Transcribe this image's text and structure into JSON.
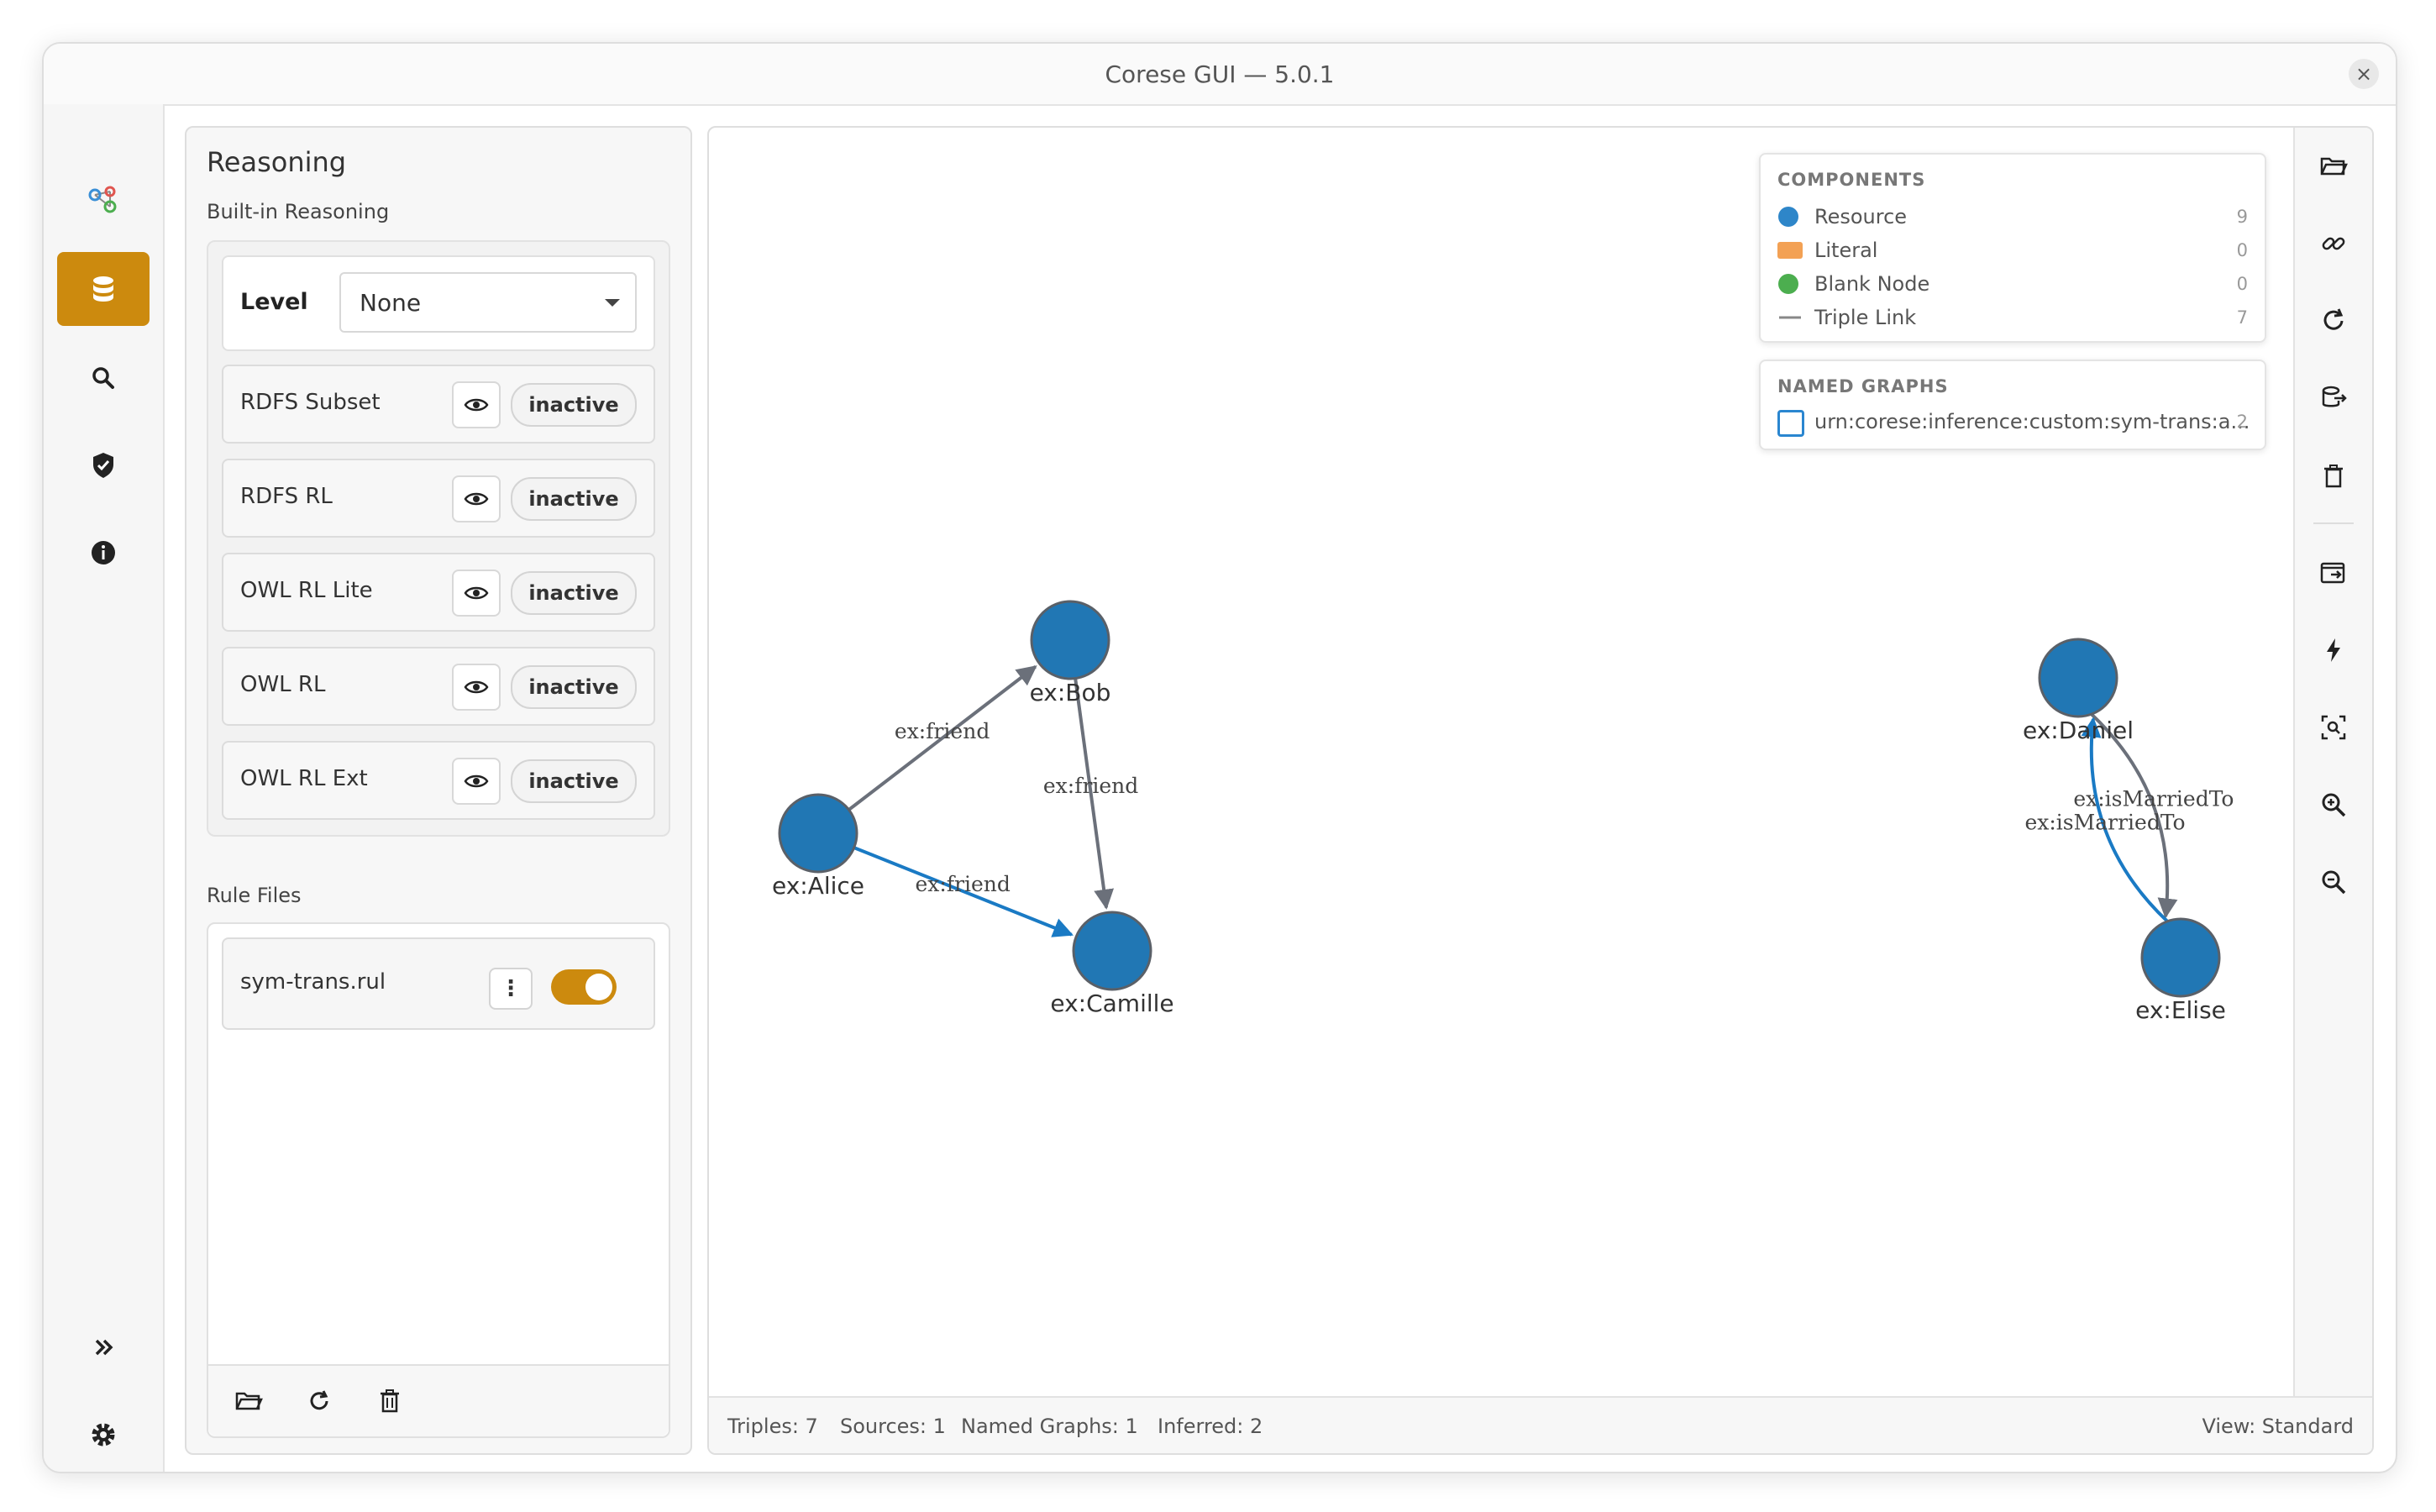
{
  "window": {
    "title": "Corese GUI — 5.0.1",
    "close_icon": "×"
  },
  "nav": {
    "items": [
      {
        "name": "graph-logo",
        "icon": "graph-logo-icon"
      },
      {
        "name": "data",
        "icon": "database-icon",
        "active": true
      },
      {
        "name": "query",
        "icon": "search-icon"
      },
      {
        "name": "validation",
        "icon": "shield-check-icon"
      },
      {
        "name": "about",
        "icon": "info-icon"
      },
      {
        "name": "expand",
        "icon": "double-chevron-right-icon"
      },
      {
        "name": "settings",
        "icon": "gear-icon"
      }
    ],
    "accent": "#cc8a0e"
  },
  "reasoning": {
    "title": "Reasoning",
    "builtin_label": "Built-in Reasoning",
    "level_label": "Level",
    "level_value": "None",
    "rules": [
      {
        "name": "RDFS Subset",
        "state": "inactive"
      },
      {
        "name": "RDFS RL",
        "state": "inactive"
      },
      {
        "name": "OWL RL Lite",
        "state": "inactive"
      },
      {
        "name": "OWL RL",
        "state": "inactive"
      },
      {
        "name": "OWL RL Ext",
        "state": "inactive"
      }
    ],
    "rule_files_label": "Rule Files",
    "files": [
      {
        "name": "sym-trans.rul",
        "enabled": true,
        "menu_glyph": "⋮"
      }
    ]
  },
  "graph": {
    "nodes": [
      {
        "id": "ex:Alice",
        "label": "ex:Alice"
      },
      {
        "id": "ex:Bob",
        "label": "ex:Bob"
      },
      {
        "id": "ex:Camille",
        "label": "ex:Camille"
      },
      {
        "id": "ex:Daniel",
        "label": "ex:Daniel"
      },
      {
        "id": "ex:Elise",
        "label": "ex:Elise"
      }
    ],
    "edges": [
      {
        "from": "ex:Alice",
        "to": "ex:Bob",
        "label": "ex:friend",
        "inferred": false
      },
      {
        "from": "ex:Bob",
        "to": "ex:Camille",
        "label": "ex:friend",
        "inferred": false
      },
      {
        "from": "ex:Alice",
        "to": "ex:Camille",
        "label": "ex:friend",
        "inferred": true
      },
      {
        "from": "ex:Daniel",
        "to": "ex:Elise",
        "label": "ex:isMarriedTo",
        "inferred": false
      },
      {
        "from": "ex:Elise",
        "to": "ex:Daniel",
        "label": "ex:isMarriedTo",
        "inferred": true
      }
    ],
    "colors": {
      "resource": "#2177b4",
      "edge": "#6b707a",
      "inferred_edge": "#1a7ac4"
    }
  },
  "legend": {
    "components_title": "COMPONENTS",
    "items": [
      {
        "label": "Resource",
        "count": "9",
        "color": "#2e86c9",
        "shape": "circle"
      },
      {
        "label": "Literal",
        "count": "0",
        "color": "#f3a154",
        "shape": "square"
      },
      {
        "label": "Blank Node",
        "count": "0",
        "color": "#4cae4f",
        "shape": "circle"
      },
      {
        "label": "Triple Link",
        "count": "7",
        "color": "#888888",
        "shape": "line"
      }
    ],
    "named_graphs_title": "NAMED GRAPHS",
    "graphs": [
      {
        "name": "urn:corese:inference:custom:sym-trans:a...",
        "count": "2"
      }
    ]
  },
  "tools": [
    "folder-open-icon",
    "link-icon",
    "refresh-icon",
    "export-icon",
    "trash-icon",
    "window-export-icon",
    "lightning-icon",
    "focus-icon",
    "zoom-in-icon",
    "zoom-out-icon"
  ],
  "status": {
    "triples": "Triples: 7",
    "sources": "Sources: 1",
    "named_graphs": "Named Graphs: 1",
    "inferred": "Inferred: 2",
    "view": "View: Standard"
  }
}
